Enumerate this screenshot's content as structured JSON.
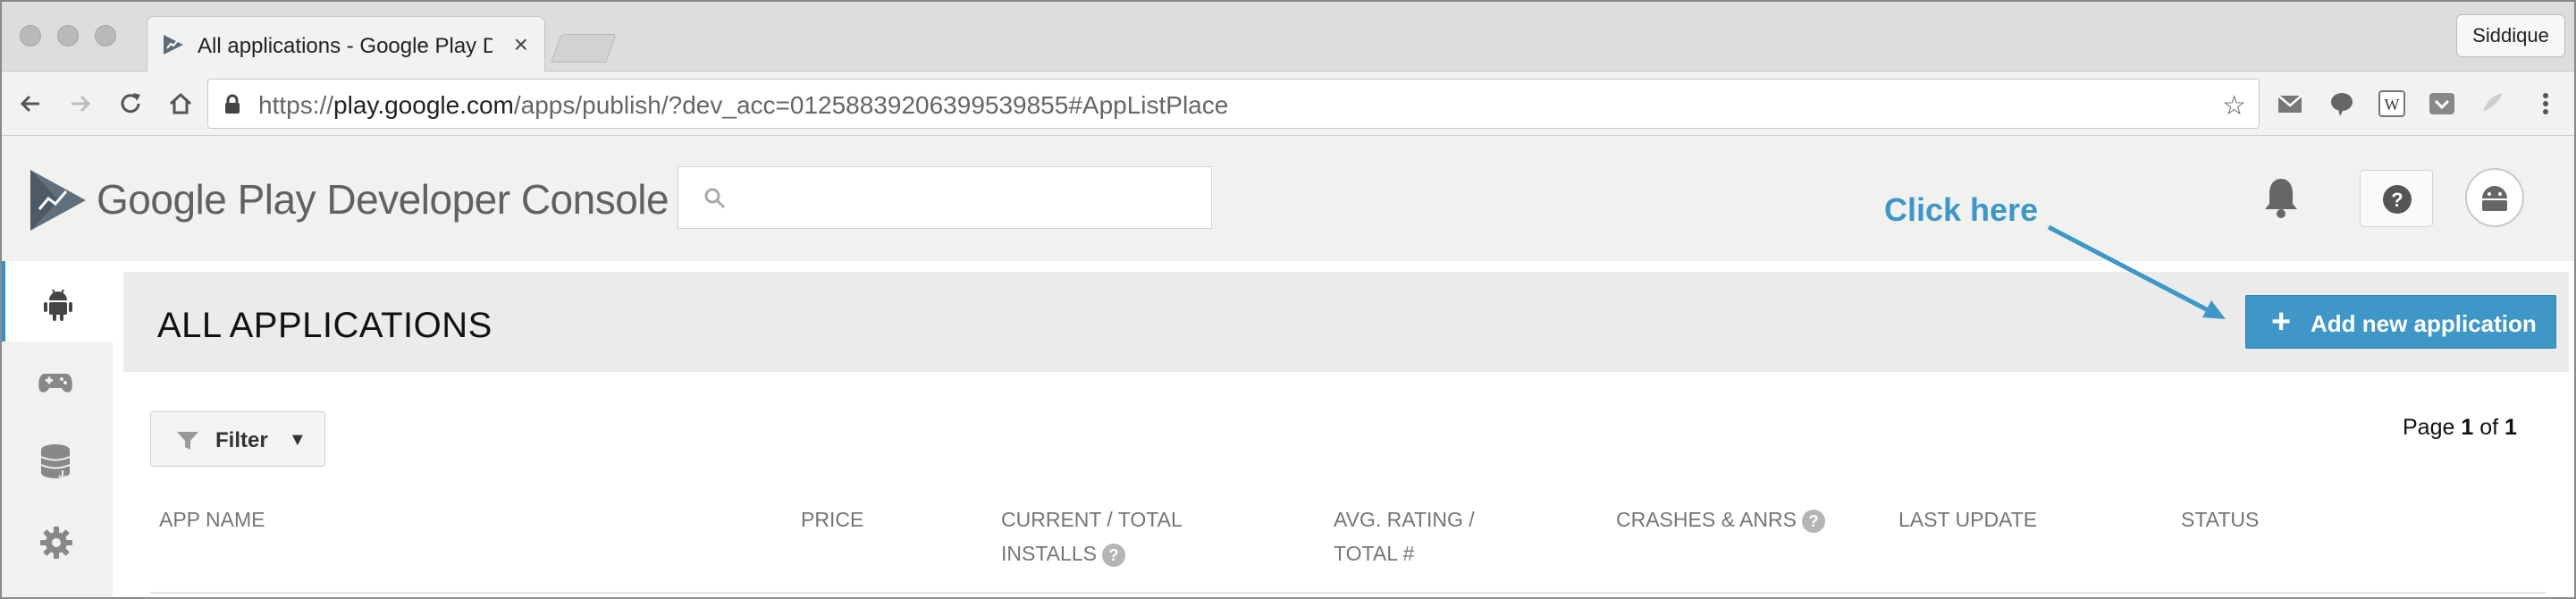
{
  "browser": {
    "tab_title": "All applications - Google Play D",
    "tab_close": "×",
    "profile_name": "Siddique",
    "url_host": "play.google.com",
    "url_path": "/apps/publish/?dev_acc=01258839206399539855#AppListPlace",
    "url_scheme": "https://",
    "star": "☆"
  },
  "header": {
    "brand": "Google Play Developer Console",
    "search_placeholder": ""
  },
  "sidebar": {
    "items": [
      {
        "icon": "android-icon",
        "active": true
      },
      {
        "icon": "gamepad-icon",
        "active": false
      },
      {
        "icon": "database-icon",
        "active": false
      },
      {
        "icon": "gear-icon",
        "active": false
      }
    ]
  },
  "main": {
    "title": "ALL APPLICATIONS",
    "add_button_plus": "+",
    "add_button_label": "Add new application",
    "filter_label": "Filter",
    "filter_caret": "▼",
    "pager_prefix": "Page ",
    "pager_current": "1",
    "pager_mid": " of ",
    "pager_total": "1",
    "columns": [
      {
        "line1": "APP NAME",
        "line2": ""
      },
      {
        "line1": "PRICE",
        "line2": ""
      },
      {
        "line1": "CURRENT / TOTAL",
        "line2": "INSTALLS"
      },
      {
        "line1": "AVG. RATING /",
        "line2": "TOTAL #"
      },
      {
        "line1": "CRASHES & ANRS",
        "line2": ""
      },
      {
        "line1": "LAST UPDATE",
        "line2": ""
      },
      {
        "line1": "STATUS",
        "line2": ""
      }
    ],
    "help_glyph": "?"
  },
  "annotation": {
    "text": "Click here"
  },
  "colors": {
    "accent": "#3e97c6",
    "sidebar_active": "#3a8fc4"
  }
}
